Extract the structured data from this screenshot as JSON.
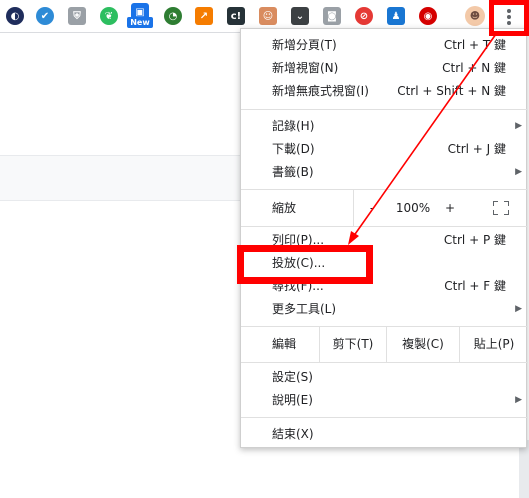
{
  "toolbar": {
    "extensions": [
      {
        "name": "ext-1-icon",
        "color": "#1f2d5c",
        "glyph": "◐"
      },
      {
        "name": "ext-2-icon",
        "color": "#2e8bd6",
        "glyph": "✔"
      },
      {
        "name": "ext-3-icon",
        "color": "#9aa0a6",
        "glyph": "⛨"
      },
      {
        "name": "evernote-icon",
        "color": "#2dbe60",
        "glyph": "❦"
      },
      {
        "name": "ext-new-icon",
        "color": "#1a73e8",
        "glyph": "▣"
      },
      {
        "name": "ext-6-icon",
        "color": "#2e7d32",
        "glyph": "◔"
      },
      {
        "name": "ext-7-icon",
        "color": "#f57c00",
        "glyph": "↗"
      },
      {
        "name": "ext-8-icon",
        "color": "#263238",
        "glyph": "c!"
      },
      {
        "name": "ext-9-icon",
        "color": "#d98c5f",
        "glyph": "☺"
      },
      {
        "name": "pocket-icon",
        "color": "#3c4043",
        "glyph": "⌄"
      },
      {
        "name": "camera-icon",
        "color": "#9aa0a6",
        "glyph": "◙"
      },
      {
        "name": "ext-12-icon",
        "color": "#e53935",
        "glyph": "⊘"
      },
      {
        "name": "ext-13-icon",
        "color": "#1976d2",
        "glyph": "♟"
      },
      {
        "name": "ext-14-icon",
        "color": "#d50000",
        "glyph": "◉"
      },
      {
        "name": "profile-avatar-icon",
        "color": "#f3c9a8",
        "glyph": "☻"
      }
    ],
    "new_badge": "New"
  },
  "menu": {
    "new_tab": {
      "label": "新增分頁(T)",
      "shortcut": "Ctrl + T 鍵"
    },
    "new_window": {
      "label": "新增視窗(N)",
      "shortcut": "Ctrl + N 鍵"
    },
    "new_incognito": {
      "label": "新增無痕式視窗(I)",
      "shortcut": "Ctrl + Shift + N 鍵"
    },
    "history": {
      "label": "記錄(H)"
    },
    "downloads": {
      "label": "下載(D)",
      "shortcut": "Ctrl + J 鍵"
    },
    "bookmarks": {
      "label": "書籤(B)"
    },
    "zoom": {
      "label": "縮放",
      "minus": "-",
      "value": "100%",
      "plus": "+"
    },
    "print": {
      "label": "列印(P)...",
      "shortcut": "Ctrl + P 鍵"
    },
    "cast": {
      "label": "投放(C)..."
    },
    "find": {
      "label": "尋找(F)...",
      "shortcut": "Ctrl + F 鍵"
    },
    "more_tools": {
      "label": "更多工具(L)"
    },
    "edit": {
      "label": "編輯",
      "cut": "剪下(T)",
      "copy": "複製(C)",
      "paste": "貼上(P)"
    },
    "settings": {
      "label": "設定(S)"
    },
    "help": {
      "label": "說明(E)"
    },
    "exit": {
      "label": "結束(X)"
    }
  },
  "colors": {
    "highlight": "#ff0000",
    "accent": "#1a73e8"
  }
}
